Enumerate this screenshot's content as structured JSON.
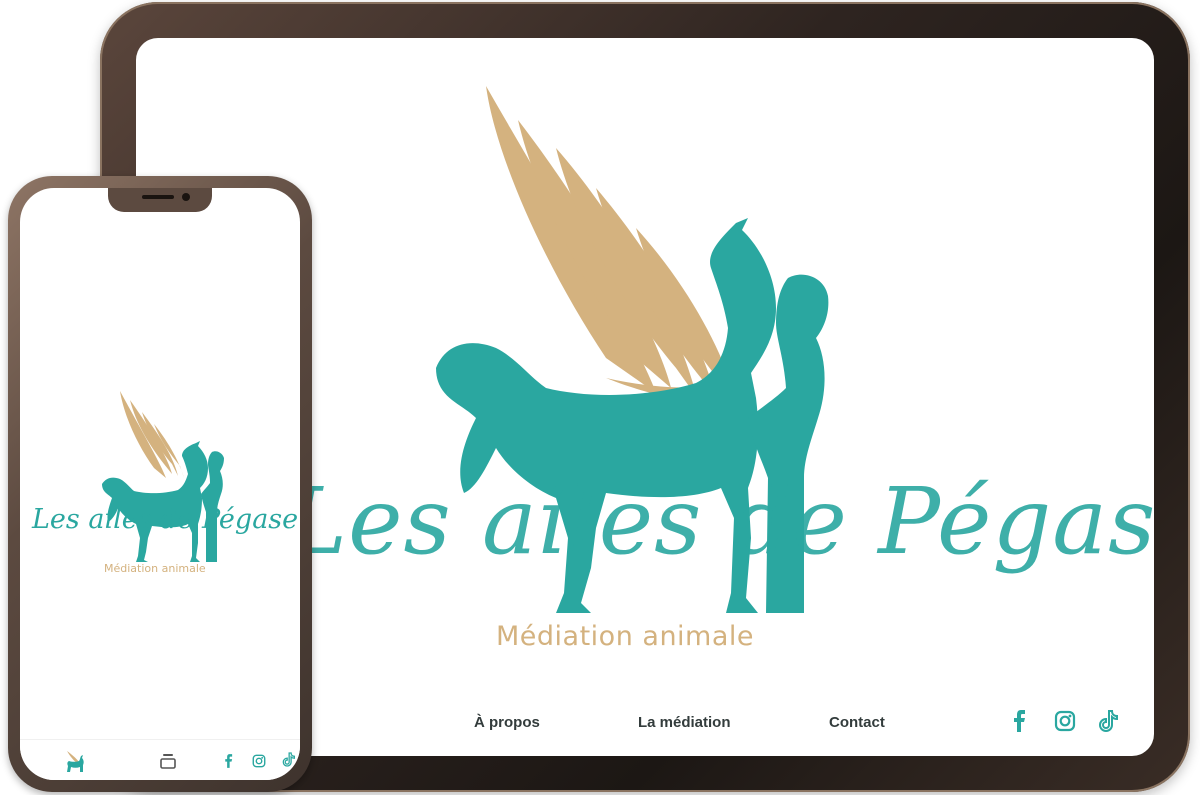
{
  "brand": {
    "name": "Les ailes de Pégase",
    "tagline": "Médiation animale",
    "colors": {
      "teal": "#2aa7a0",
      "gold": "#d4b27f",
      "nav_text": "#333c3c"
    }
  },
  "tablet": {
    "nav": {
      "items": [
        {
          "label": "À propos"
        },
        {
          "label": "La médiation"
        },
        {
          "label": "Contact"
        }
      ],
      "social": [
        "facebook-icon",
        "instagram-icon",
        "tiktok-icon"
      ]
    }
  },
  "phone": {
    "bottom_bar": {
      "icons": [
        "logo-icon",
        "menu-icon",
        "facebook-icon",
        "instagram-icon",
        "tiktok-icon"
      ]
    }
  }
}
